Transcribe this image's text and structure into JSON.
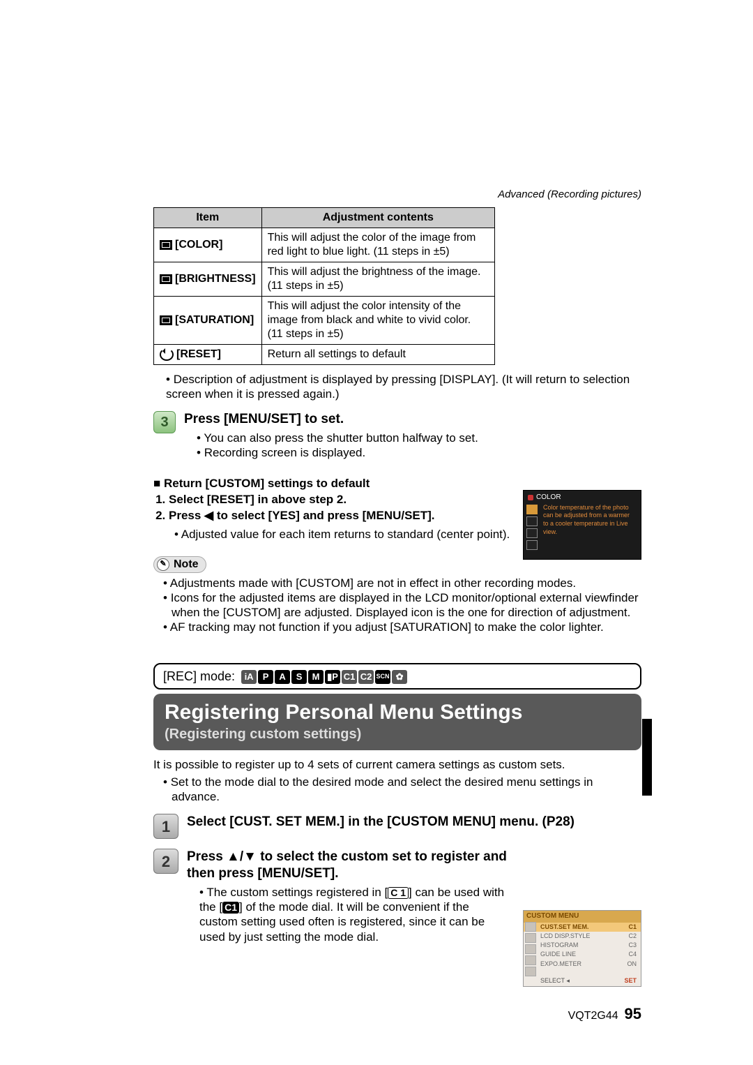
{
  "header": {
    "section_label": "Advanced (Recording pictures)"
  },
  "adjust_table": {
    "head": {
      "item": "Item",
      "contents": "Adjustment contents"
    },
    "rows": [
      {
        "name": "[COLOR]",
        "desc": "This will adjust the color of the image from red light to blue light. (11 steps in ±5)"
      },
      {
        "name": "[BRIGHTNESS]",
        "desc": "This will adjust the brightness of the image. (11 steps in ±5)"
      },
      {
        "name": "[SATURATION]",
        "desc": "This will adjust the color intensity of the image from black and white to vivid color. (11 steps in ±5)"
      },
      {
        "name": "[RESET]",
        "desc": "Return all settings to default"
      }
    ]
  },
  "after_table_note": "Description of adjustment is displayed by pressing [DISPLAY]. (It will return to selection screen when it is pressed again.)",
  "step3": {
    "num": "3",
    "title": "Press [MENU/SET] to set.",
    "bullets": [
      "You can also press the shutter button halfway to set.",
      "Recording screen is displayed."
    ]
  },
  "return_custom_heading": "Return [CUSTOM] settings to default",
  "return_custom_steps": [
    "Select [RESET] in above step 2.",
    "Press ◀ to select [YES] and press [MENU/SET]."
  ],
  "return_custom_sub": "Adjusted value for each item returns to standard (center point).",
  "note_label": "Note",
  "notes": [
    "Adjustments made with [CUSTOM] are not in effect in other recording modes.",
    "Icons for the adjusted items are displayed in the LCD monitor/optional external viewfinder when the [CUSTOM] are adjusted. Displayed icon is the one for direction of adjustment.",
    "AF tracking may not function if you adjust [SATURATION] to make the color lighter."
  ],
  "rec_mode_label": "[REC] mode:",
  "mode_icons": [
    "iA",
    "P",
    "A",
    "S",
    "M",
    "▮P",
    "C1",
    "C2",
    "SCN",
    "✿"
  ],
  "title_main": "Registering Personal Menu Settings",
  "title_sub": "(Registering custom settings)",
  "intro_line": "It is possible to register up to 4 sets of current camera settings as custom sets.",
  "intro_bullet": "Set to the mode dial to the desired mode and select the desired menu settings in advance.",
  "step1": {
    "num": "1",
    "title": "Select [CUST. SET MEM.] in the [CUSTOM MENU] menu. (P28)"
  },
  "step2": {
    "num": "2",
    "title": "Press ▲/▼ to select the custom set to register and then press [MENU/SET].",
    "body_a": "The custom settings registered in [",
    "body_b": "] can be used with the [",
    "body_c": "] of the mode dial. It will be convenient if the custom setting used often is registered, since it can be used by just setting the mode dial.",
    "c1_open": "C 1",
    "c1_solid": "C1"
  },
  "lcd1": {
    "title": "COLOR",
    "lines": "Color temperature of the photo can be adjusted from a warmer to a cooler temperature in Live view."
  },
  "lcd2": {
    "title": "CUSTOM MENU",
    "rows": [
      {
        "l": "CUST.SET MEM.",
        "r": "C1"
      },
      {
        "l": "LCD DISP.STYLE",
        "r": "C2"
      },
      {
        "l": "HISTOGRAM",
        "r": "C3"
      },
      {
        "l": "GUIDE LINE",
        "r": "C4"
      },
      {
        "l": "EXPO.METER",
        "r": "ON"
      }
    ],
    "footer_l": "SELECT ◂",
    "footer_r": "SET"
  },
  "footer": {
    "code": "VQT2G44",
    "page": "95"
  }
}
